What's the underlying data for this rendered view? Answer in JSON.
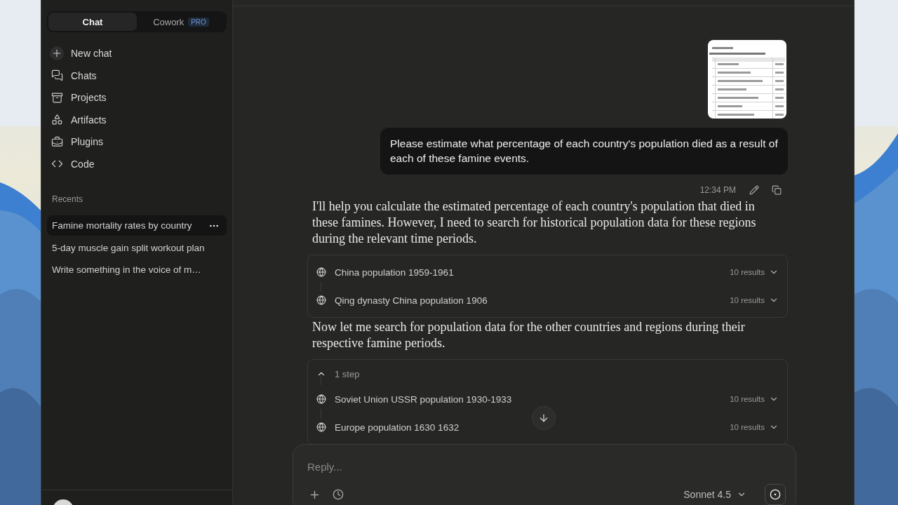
{
  "sidebar": {
    "mode_tabs": [
      {
        "label": "Chat",
        "selected": true
      },
      {
        "label": "Cowork",
        "badge": "PRO",
        "selected": false
      }
    ],
    "nav": [
      {
        "label": "New chat"
      },
      {
        "label": "Chats"
      },
      {
        "label": "Projects"
      },
      {
        "label": "Artifacts"
      },
      {
        "label": "Plugins"
      },
      {
        "label": "Code"
      }
    ],
    "recents_label": "Recents",
    "recents": [
      {
        "title": "Famine mortality rates by country",
        "selected": true
      },
      {
        "title": "5-day muscle gain split workout plan",
        "selected": false
      },
      {
        "title": "Write something in the voice of m…",
        "selected": false
      }
    ]
  },
  "conversation": {
    "user_message": {
      "text": "Please estimate what percentage of each country's population died as a result of each of these famine events.",
      "time": "12:34 PM"
    },
    "assistant_blocks": [
      {
        "kind": "text",
        "text": "I'll help you calculate the estimated percentage of each country's population that died in these famines. However, I need to search for historical population data for these regions during the relevant time periods."
      },
      {
        "kind": "search",
        "searches": [
          {
            "query": "China population 1959-1961",
            "results": "10 results"
          },
          {
            "query": "Qing dynasty China population 1906",
            "results": "10 results"
          }
        ]
      },
      {
        "kind": "text",
        "text": "Now let me search for population data for the other countries and regions during their respective famine periods."
      },
      {
        "kind": "search",
        "step_label": "1 step",
        "expanded": true,
        "searches": [
          {
            "query": "Soviet Union USSR population 1930-1933",
            "results": "10 results"
          },
          {
            "query": "Europe population 1630 1632",
            "results": "10 results"
          }
        ]
      }
    ]
  },
  "composer": {
    "placeholder": "Reply...",
    "model": "Sonnet 4.5"
  }
}
